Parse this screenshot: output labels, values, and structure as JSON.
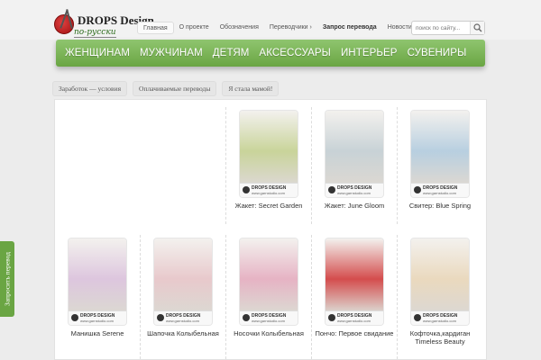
{
  "logo": {
    "title": "DROPS Design",
    "subtitle": "по-русски"
  },
  "topnav": [
    "Главная",
    "О проекте",
    "Обозначения",
    "Переводчики ›",
    "Запрос перевода",
    "Новости"
  ],
  "search": {
    "placeholder": "поиск по сайту..."
  },
  "mainnav": [
    "ЖЕНЩИНАМ",
    "МУЖЧИНАМ",
    "ДЕТЯМ",
    "АКСЕССУАРЫ",
    "ИНТЕРЬЕР",
    "СУВЕНИРЫ"
  ],
  "subnav": [
    "Заработок — условия",
    "Оплачиваемые переводы",
    "Я стала мамой!"
  ],
  "brand_label": {
    "name": "DROPS DESIGN",
    "url": "www.garnstudio.com"
  },
  "products_row1": [
    {
      "caption": "Жакет: Secret Garden",
      "color": "#c9d49a"
    },
    {
      "caption": "Жакет: June Gloom",
      "color": "#c8d2d6"
    },
    {
      "caption": "Свитер: Blue Spring",
      "color": "#b8cfe0"
    }
  ],
  "products_row2": [
    {
      "caption": "Манишка Serene",
      "color": "#ddc6de"
    },
    {
      "caption": "Шапочка Колыбельная",
      "color": "#e8c9cc"
    },
    {
      "caption": "Носочки Колыбельная",
      "color": "#e6b3c4"
    },
    {
      "caption": "Пончо: Первое свидание",
      "color": "#d44d4d"
    },
    {
      "caption": "Кофточка,кардиган Timeless Beauty",
      "color": "#ead9be"
    }
  ],
  "side_tab": "Запросить перевод",
  "colors": {
    "accent": "#6aa543",
    "background": "#ececec"
  }
}
